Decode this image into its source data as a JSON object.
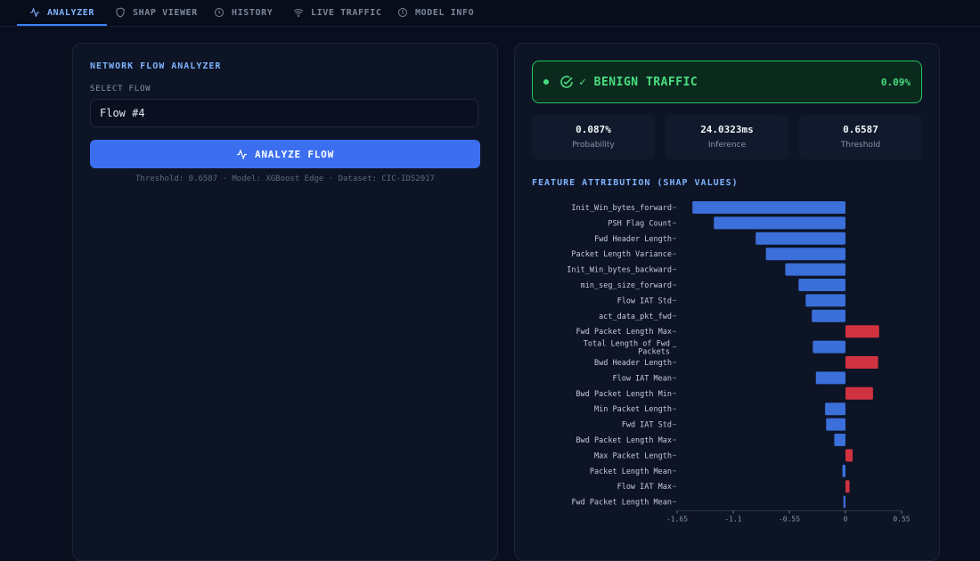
{
  "nav": {
    "tabs": [
      {
        "label": "ANALYZER",
        "icon": "activity-icon",
        "active": true
      },
      {
        "label": "SHAP VIEWER",
        "icon": "shield-icon",
        "active": false
      },
      {
        "label": "HISTORY",
        "icon": "clock-icon",
        "active": false
      },
      {
        "label": "LIVE TRAFFIC",
        "icon": "wifi-icon",
        "active": false
      },
      {
        "label": "MODEL INFO",
        "icon": "info-icon",
        "active": false
      }
    ]
  },
  "left": {
    "title": "NETWORK FLOW ANALYZER",
    "select_label": "SELECT FLOW",
    "selected_flow": "Flow #4",
    "analyze_label": "ANALYZE FLOW",
    "meta": "Threshold: 0.6587 · Model: XGBoost Edge · Dataset: CIC-IDS2017"
  },
  "result": {
    "status_label": "✓ BENIGN TRAFFIC",
    "status_pct": "0.09%",
    "status_color": "#4ade80",
    "stats": [
      {
        "value": "0.087%",
        "label": "Probability"
      },
      {
        "value": "24.0323ms",
        "label": "Inference"
      },
      {
        "value": "0.6587",
        "label": "Threshold"
      }
    ],
    "chart_title": "FEATURE ATTRIBUTION (SHAP VALUES)"
  },
  "chart_data": {
    "type": "bar",
    "orientation": "horizontal",
    "title": "FEATURE ATTRIBUTION (SHAP VALUES)",
    "categories": [
      "Init_Win_bytes_forward",
      "PSH Flag Count",
      "Fwd Header Length",
      "Packet Length Variance",
      "Init_Win_bytes_backward",
      "min_seg_size_forward",
      "Flow IAT Std",
      "act_data_pkt_fwd",
      "Fwd Packet Length Max",
      "Total Length of Fwd Packets",
      "Bwd Header Length",
      "Flow IAT Mean",
      "Bwd Packet Length Min",
      "Min Packet Length",
      "Fwd IAT Std",
      "Bwd Packet Length Max",
      "Max Packet Length",
      "Packet Length Mean",
      "Flow IAT Max",
      "Fwd Packet Length Mean"
    ],
    "values": [
      -1.5,
      -1.29,
      -0.88,
      -0.78,
      -0.59,
      -0.46,
      -0.39,
      -0.33,
      0.33,
      -0.32,
      0.32,
      -0.29,
      0.27,
      -0.2,
      -0.19,
      -0.11,
      0.07,
      -0.03,
      0.04,
      -0.02
    ],
    "xlim": [
      -1.65,
      0.55
    ],
    "xticks": [
      -1.65,
      -1.1,
      -0.55,
      0,
      0.55
    ],
    "colors": {
      "negative": "#3b6fd9",
      "positive": "#d1323f"
    }
  }
}
